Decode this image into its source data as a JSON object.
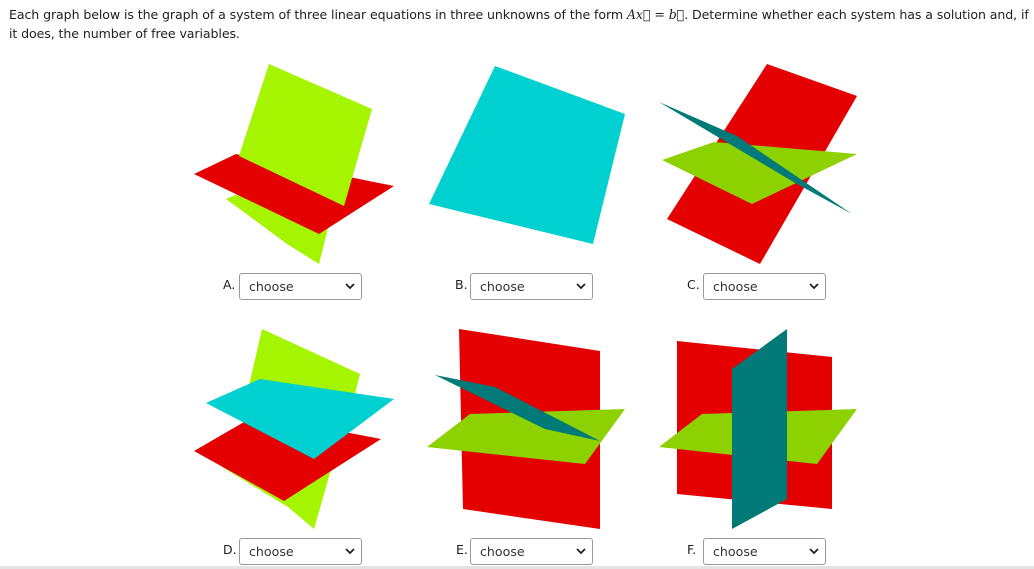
{
  "question": {
    "text_before": "Each graph below is the graph of a system of three linear equations in three unknowns of the form ",
    "math": "Ax⃗ = b⃗",
    "text_after": ". Determine whether each system has a solution and, if it does, the number of free variables."
  },
  "graphs": [
    {
      "letter": "A.",
      "select_value": "choose",
      "icon": "chevron-down-icon"
    },
    {
      "letter": "B.",
      "select_value": "choose",
      "icon": "chevron-down-icon"
    },
    {
      "letter": "C.",
      "select_value": "choose",
      "icon": "chevron-down-icon"
    },
    {
      "letter": "D.",
      "select_value": "choose",
      "icon": "chevron-down-icon"
    },
    {
      "letter": "E.",
      "select_value": "choose",
      "icon": "chevron-down-icon"
    },
    {
      "letter": "F.",
      "select_value": "choose",
      "icon": "chevron-down-icon"
    }
  ],
  "colors": {
    "red": "#e40000",
    "lime": "#a6f500",
    "green": "#8ed100",
    "cyan": "#00d0d0",
    "teal": "#007a78"
  }
}
